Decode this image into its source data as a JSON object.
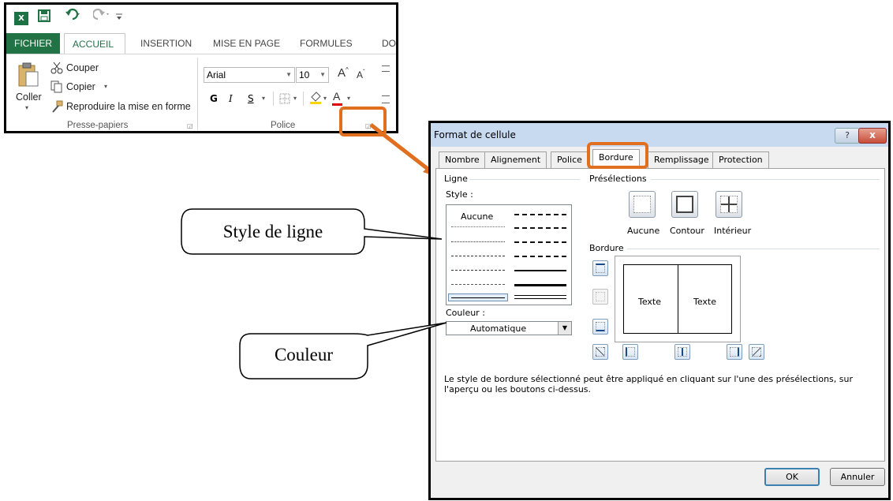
{
  "ribbon": {
    "logo_glyph": "X",
    "tabs": [
      "FICHIER",
      "ACCUEIL",
      "INSERTION",
      "MISE EN PAGE",
      "FORMULES",
      "DON"
    ],
    "clipboard": {
      "paste": "Coller",
      "cut": "Couper",
      "copy": "Copier",
      "format_painter": "Reproduire la mise en forme",
      "group_label": "Presse-papiers"
    },
    "font": {
      "font_name": "Arial",
      "font_size": "10",
      "bold": "G",
      "italic": "I",
      "underline": "S",
      "group_label": "Police"
    }
  },
  "dialog": {
    "title": "Format de cellule",
    "help_label": "?",
    "close_label": "x",
    "tabs": [
      "Nombre",
      "Alignement",
      "Police",
      "Bordure",
      "Remplissage",
      "Protection"
    ],
    "selected_tab": "Bordure",
    "line_group": "Ligne",
    "style_label": "Style :",
    "style_none": "Aucune",
    "color_label": "Couleur :",
    "color_value": "Automatique",
    "presets_group": "Présélections",
    "presets": [
      "Aucune",
      "Contour",
      "Intérieur"
    ],
    "border_group": "Bordure",
    "preview_text_left": "Texte",
    "preview_text_right": "Texte",
    "hint": "Le style de bordure sélectionné peut être appliqué en cliquant sur l'une des présélections, sur l'aperçu ou les boutons ci-dessus.",
    "ok": "OK",
    "cancel": "Annuler"
  },
  "callouts": {
    "line_style": "Style de ligne",
    "color": "Couleur"
  },
  "colors": {
    "excel_green": "#217346",
    "highlight_orange": "#e07020",
    "title_bar": "#c8daf0"
  }
}
